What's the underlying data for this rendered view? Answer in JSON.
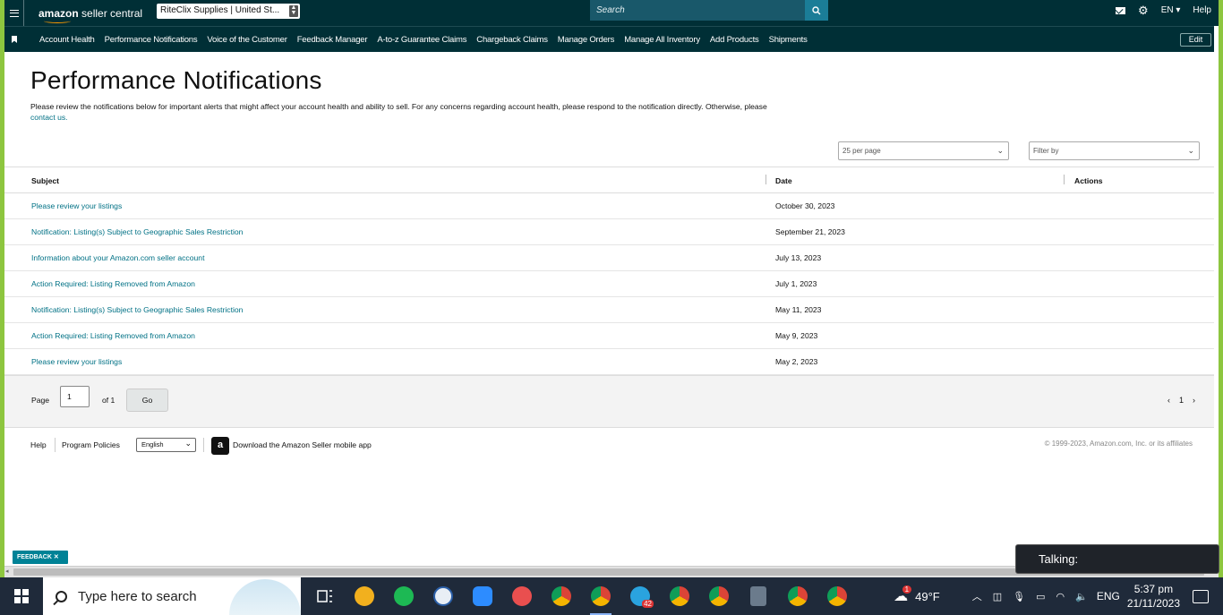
{
  "header": {
    "logo_text_bold": "amazon",
    "logo_text_rest": " seller central",
    "store_selector": "RiteClix Supplies | United St...",
    "search_placeholder": "Search",
    "language": "EN",
    "help": "Help"
  },
  "nav": {
    "items": [
      "Account Health",
      "Performance Notifications",
      "Voice of the Customer",
      "Feedback Manager",
      "A-to-z Guarantee Claims",
      "Chargeback Claims",
      "Manage Orders",
      "Manage All Inventory",
      "Add Products",
      "Shipments"
    ],
    "edit": "Edit"
  },
  "page": {
    "title": "Performance Notifications",
    "description": "Please review the notifications below for important alerts that might affect your account health and ability to sell. For any concerns regarding account health, please respond to the notification directly. Otherwise, please",
    "contact_link": "contact us.",
    "per_page": "25 per page",
    "filter_placeholder": "Filter by"
  },
  "table": {
    "headers": {
      "subject": "Subject",
      "date": "Date",
      "actions": "Actions"
    },
    "rows": [
      {
        "subject": "Please review your listings",
        "date": "October 30, 2023"
      },
      {
        "subject": "Notification: Listing(s) Subject to Geographic Sales Restriction",
        "date": "September 21, 2023"
      },
      {
        "subject": "Information about your Amazon.com seller account",
        "date": "July 13, 2023"
      },
      {
        "subject": "Action Required: Listing Removed from Amazon",
        "date": "July 1, 2023"
      },
      {
        "subject": "Notification: Listing(s) Subject to Geographic Sales Restriction",
        "date": "May 11, 2023"
      },
      {
        "subject": "Action Required: Listing Removed from Amazon",
        "date": "May 9, 2023"
      },
      {
        "subject": "Please review your listings",
        "date": "May 2, 2023"
      }
    ]
  },
  "pagination": {
    "page_label": "Page",
    "page_value": "1",
    "of_label": "of 1",
    "go": "Go",
    "prev": "‹",
    "current": "1",
    "next": "›"
  },
  "footer": {
    "help": "Help",
    "policies": "Program Policies",
    "language": "English",
    "app_icon": "a",
    "app": "Download the Amazon Seller mobile app",
    "copyright": "© 1999-2023, Amazon.com, Inc. or its affiliates"
  },
  "feedback": "FEEDBACK ✕",
  "talking": "Talking:",
  "taskbar": {
    "search_placeholder": "Type here to search",
    "weather": "49°F",
    "lang": "ENG",
    "time": "5:37 pm",
    "date": "21/11/2023",
    "telegram_badge": "42",
    "weather_badge": "1",
    "icons": [
      {
        "name": "task-view-icon",
        "color": "#ffffff"
      },
      {
        "name": "explorer-icon",
        "color": "#f2b01e"
      },
      {
        "name": "spotify-icon",
        "color": "#1db954"
      },
      {
        "name": "clock-app-icon",
        "color": "#e8eef5"
      },
      {
        "name": "zoom-icon",
        "color": "#2d8cff"
      },
      {
        "name": "snipping-icon",
        "color": "#e94f4f"
      },
      {
        "name": "chrome-icon-1",
        "color": "#db4437"
      },
      {
        "name": "chrome-icon-2",
        "color": "#db4437"
      },
      {
        "name": "telegram-icon",
        "color": "#2aa3df"
      },
      {
        "name": "chrome-icon-3",
        "color": "#db4437"
      },
      {
        "name": "chrome-icon-4",
        "color": "#db4437"
      },
      {
        "name": "calculator-icon",
        "color": "#6b7b8c"
      },
      {
        "name": "chrome-icon-5",
        "color": "#db4437"
      },
      {
        "name": "chrome-icon-6",
        "color": "#db4437"
      }
    ]
  }
}
